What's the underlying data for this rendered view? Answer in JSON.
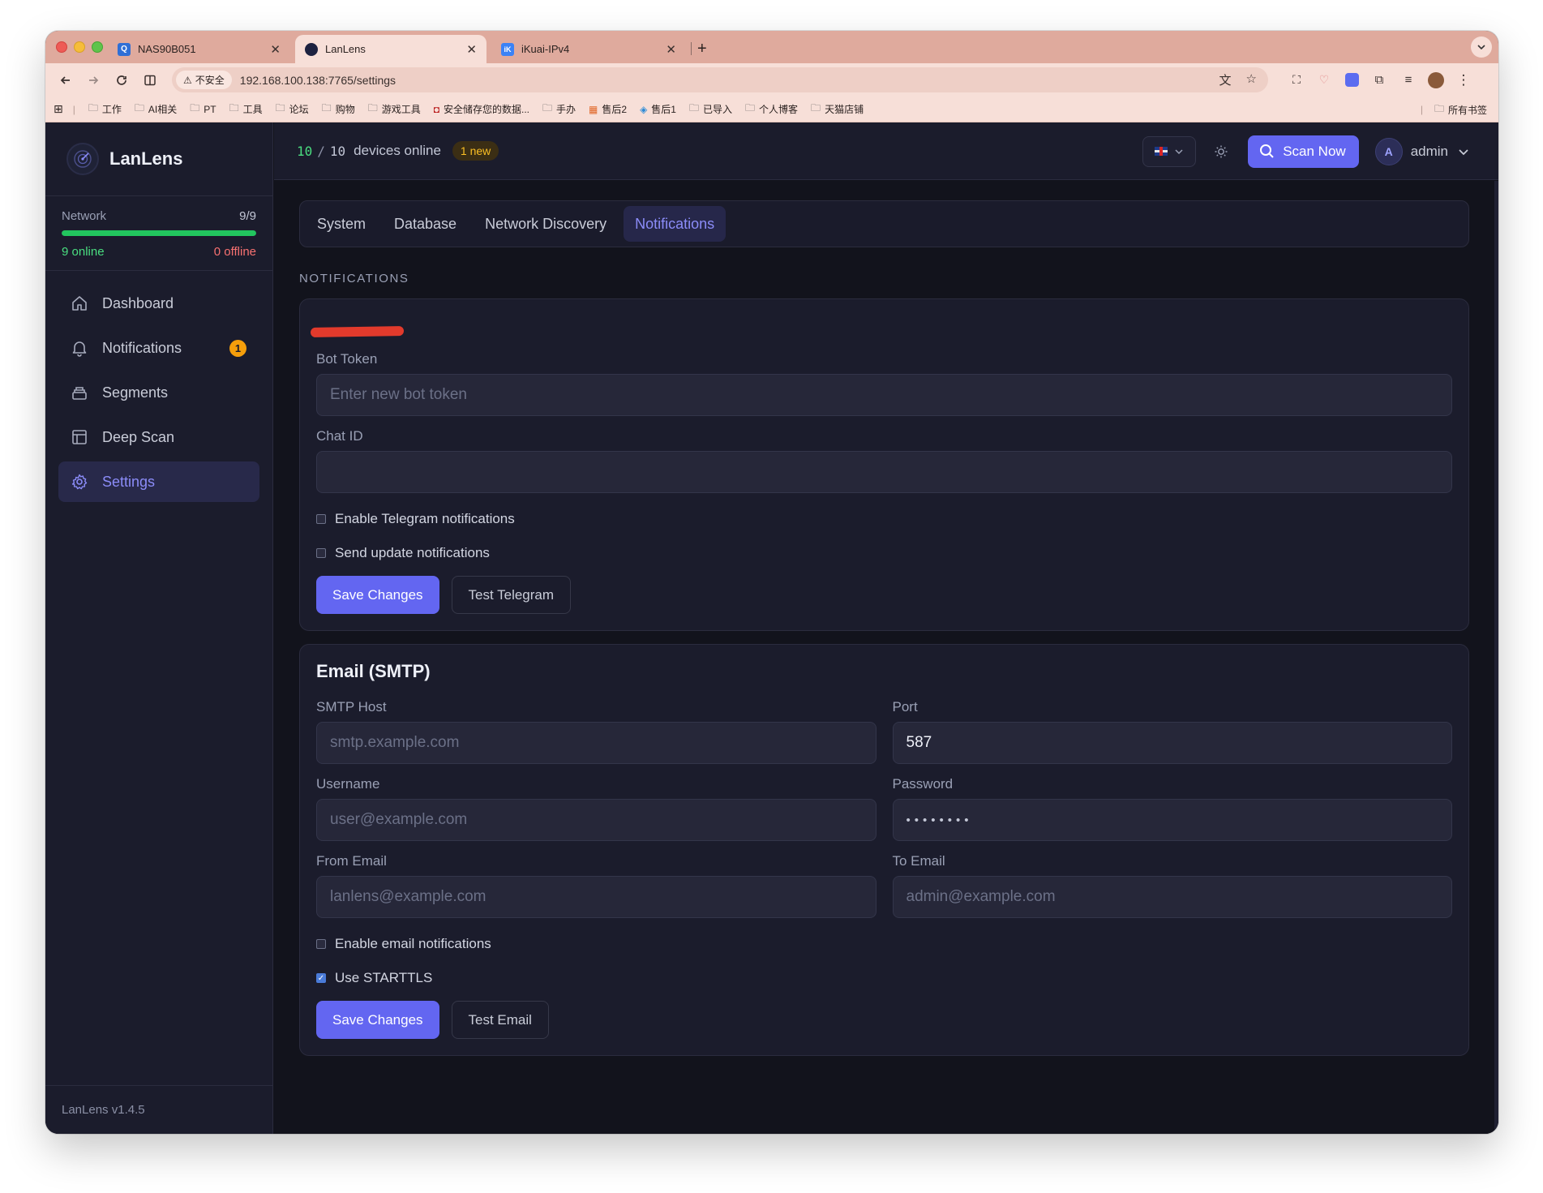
{
  "browser": {
    "tabs": [
      {
        "title": "NAS90B051",
        "favicon_color": "#2f6fd6",
        "favicon_glyph": "Q"
      },
      {
        "title": "LanLens",
        "favicon_color": "#1d2240",
        "favicon_glyph": "•"
      },
      {
        "title": "iKuai-IPv4",
        "favicon_color": "#3b82f6",
        "favicon_glyph": "iK"
      }
    ],
    "new_tab_label": "+",
    "security_label": "不安全",
    "url": "192.168.100.138:7765/settings",
    "bookmarks": [
      "工作",
      "AI相关",
      "PT",
      "工具",
      "论坛",
      "购物",
      "游戏工具",
      "安全储存您的数据...",
      "手办",
      "售后2",
      "售后1",
      "已导入",
      "个人博客",
      "天猫店铺"
    ],
    "all_bookmarks_label": "所有书签"
  },
  "app": {
    "brand": "LanLens",
    "accent": "#6366f1",
    "network": {
      "label": "Network",
      "count": "9/9",
      "online_fraction": 1.0,
      "online_label": "9 online",
      "offline_label": "0 offline"
    },
    "nav": [
      {
        "label": "Dashboard",
        "icon": "home-icon"
      },
      {
        "label": "Notifications",
        "icon": "bell-icon",
        "badge": "1"
      },
      {
        "label": "Segments",
        "icon": "layers-icon"
      },
      {
        "label": "Deep Scan",
        "icon": "table-icon"
      },
      {
        "label": "Settings",
        "icon": "gear-icon",
        "active": true
      }
    ],
    "version": "LanLens v1.4.5",
    "header": {
      "online_count": "10",
      "separator": "/",
      "total_count": "10",
      "status_text": "devices online",
      "new_badge": "1 new",
      "scan_label": "Scan Now",
      "avatar_letter": "A",
      "user_name": "admin"
    },
    "settings_tabs": [
      "System",
      "Database",
      "Network Discovery",
      "Notifications"
    ],
    "active_tab": "Notifications",
    "section_label": "NOTIFICATIONS",
    "telegram": {
      "bot_token_label": "Bot Token",
      "bot_token_placeholder": "Enter new bot token",
      "chat_id_label": "Chat ID",
      "chat_id_value": "",
      "enable_label": "Enable Telegram notifications",
      "enable_checked": false,
      "update_label": "Send update notifications",
      "update_checked": false,
      "save_label": "Save Changes",
      "test_label": "Test Telegram"
    },
    "email": {
      "title": "Email (SMTP)",
      "host_label": "SMTP Host",
      "host_placeholder": "smtp.example.com",
      "port_label": "Port",
      "port_value": "587",
      "username_label": "Username",
      "username_placeholder": "user@example.com",
      "password_label": "Password",
      "password_value": "••••••••",
      "from_label": "From Email",
      "from_placeholder": "lanlens@example.com",
      "to_label": "To Email",
      "to_placeholder": "admin@example.com",
      "enable_label": "Enable email notifications",
      "enable_checked": false,
      "starttls_label": "Use STARTTLS",
      "starttls_checked": true,
      "save_label": "Save Changes",
      "test_label": "Test Email"
    }
  }
}
